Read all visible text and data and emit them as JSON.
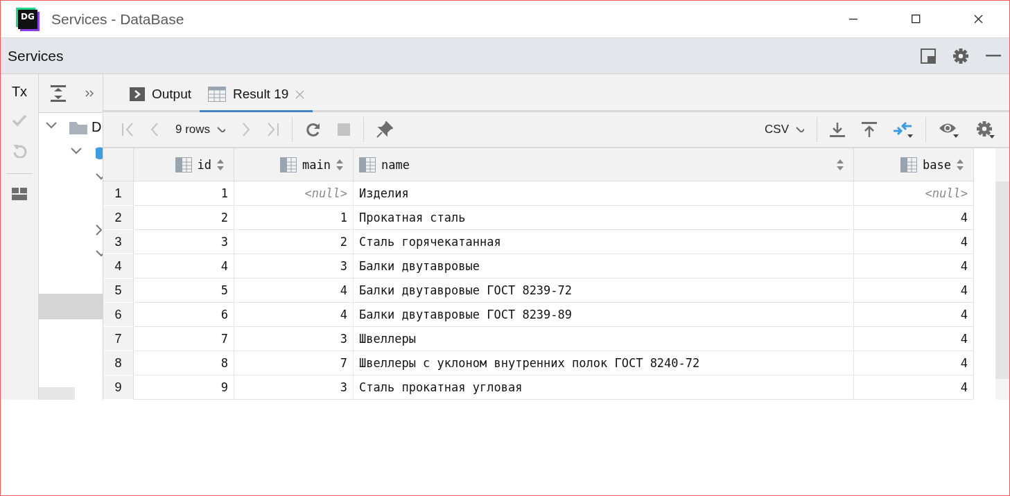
{
  "window": {
    "title": "Services - DataBase",
    "logo_text": "DG"
  },
  "tool_window": {
    "title": "Services"
  },
  "side_toolbar": [
    {
      "kind": "tx",
      "label": "Tx",
      "disabled": false
    },
    {
      "kind": "commit",
      "disabled": true
    },
    {
      "kind": "rollback",
      "disabled": true
    },
    {
      "kind": "layout",
      "disabled": false
    }
  ],
  "tree": {
    "items": [
      {
        "kind": "folder",
        "label": "D",
        "expanded": true,
        "selected": false,
        "children": [
          {
            "kind": "database",
            "expanded": true,
            "selected": false,
            "children": [
              {
                "expanded": true,
                "selected": false,
                "children": [
                  {
                    "selected": false
                  }
                ]
              },
              {
                "expanded": false,
                "selected": false
              },
              {
                "expanded": true,
                "selected": false,
                "children": [
                  {
                    "selected": false
                  },
                  {
                    "selected": true
                  }
                ]
              }
            ]
          }
        ]
      }
    ]
  },
  "tabs": [
    {
      "kind": "console",
      "label": "Output",
      "selected": false,
      "closable": false
    },
    {
      "kind": "table",
      "label": "Result 19",
      "selected": true,
      "closable": true
    }
  ],
  "toolbar": {
    "rows": "9 rows",
    "format": "CSV"
  },
  "table": {
    "columns": [
      {
        "name": "id",
        "kind": "number"
      },
      {
        "name": "main",
        "kind": "number"
      },
      {
        "name": "name",
        "kind": "text"
      },
      {
        "name": "base",
        "kind": "number"
      }
    ],
    "rows": [
      {
        "num": "1",
        "cells": [
          {
            "text": "1",
            "null": false
          },
          {
            "text": "<null>",
            "null": true
          },
          {
            "text": "Изделия",
            "null": false
          },
          {
            "text": "<null>",
            "null": true
          }
        ]
      },
      {
        "num": "2",
        "cells": [
          {
            "text": "2",
            "null": false
          },
          {
            "text": "1",
            "null": false
          },
          {
            "text": "Прокатная сталь",
            "null": false
          },
          {
            "text": "4",
            "null": false
          }
        ]
      },
      {
        "num": "3",
        "cells": [
          {
            "text": "3",
            "null": false
          },
          {
            "text": "2",
            "null": false
          },
          {
            "text": "Сталь горячекатанная",
            "null": false
          },
          {
            "text": "4",
            "null": false
          }
        ]
      },
      {
        "num": "4",
        "cells": [
          {
            "text": "4",
            "null": false
          },
          {
            "text": "3",
            "null": false
          },
          {
            "text": "Балки двутавровые",
            "null": false
          },
          {
            "text": "4",
            "null": false
          }
        ]
      },
      {
        "num": "5",
        "cells": [
          {
            "text": "5",
            "null": false
          },
          {
            "text": "4",
            "null": false
          },
          {
            "text": "Балки двутавровые ГОСТ 8239-72",
            "null": false
          },
          {
            "text": "4",
            "null": false
          }
        ]
      },
      {
        "num": "6",
        "cells": [
          {
            "text": "6",
            "null": false
          },
          {
            "text": "4",
            "null": false
          },
          {
            "text": "Балки двутавровые ГОСТ 8239-89",
            "null": false
          },
          {
            "text": "4",
            "null": false
          }
        ]
      },
      {
        "num": "7",
        "cells": [
          {
            "text": "7",
            "null": false
          },
          {
            "text": "3",
            "null": false
          },
          {
            "text": "Швеллеры",
            "null": false
          },
          {
            "text": "4",
            "null": false
          }
        ]
      },
      {
        "num": "8",
        "cells": [
          {
            "text": "8",
            "null": false
          },
          {
            "text": "7",
            "null": false
          },
          {
            "text": "Швеллеры с уклоном внутренних полок ГОСТ 8240-72",
            "null": false
          },
          {
            "text": "4",
            "null": false
          }
        ]
      },
      {
        "num": "9",
        "cells": [
          {
            "text": "9",
            "null": false
          },
          {
            "text": "3",
            "null": false
          },
          {
            "text": "Сталь прокатная угловая",
            "null": false
          },
          {
            "text": "4",
            "null": false
          }
        ]
      }
    ]
  }
}
